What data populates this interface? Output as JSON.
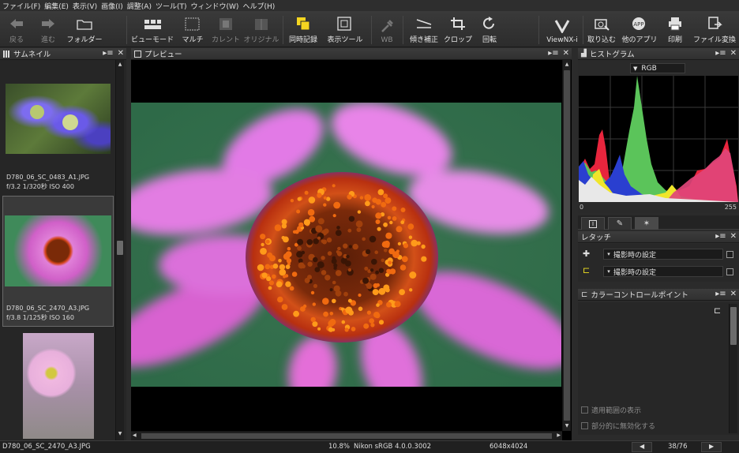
{
  "menu": [
    "ファイル(F)",
    "編集(E)",
    "表示(V)",
    "画像(I)",
    "調整(A)",
    "ツール(T)",
    "ウィンドウ(W)",
    "ヘルプ(H)"
  ],
  "toolbar": {
    "back": "戻る",
    "forward": "進む",
    "folder": "フォルダー",
    "view_mode": "ビューモード",
    "multi": "マルチ",
    "current": "カレント",
    "original": "オリジナル",
    "sync_record": "同時記録",
    "display_tool": "表示ツール",
    "wb": "WB",
    "tilt": "傾き補正",
    "crop": "クロップ",
    "rotate": "回転",
    "viewnx": "ViewNX-i",
    "import": "取り込む",
    "other_app": "他のアプリ",
    "print": "印刷",
    "file_convert": "ファイル変換"
  },
  "thumbnail_panel": {
    "title": "サムネイル",
    "items": [
      {
        "filename": "D780_06_SC_0483_A1.JPG",
        "info": "f/3.2 1/320秒 ISO 400"
      },
      {
        "filename": "D780_06_SC_2470_A3.JPG",
        "info": "f/3.8 1/125秒 ISO 160"
      }
    ]
  },
  "preview_panel": {
    "title": "プレビュー"
  },
  "histogram_panel": {
    "title": "ヒストグラム",
    "channel": "RGB",
    "min": "0",
    "max": "255"
  },
  "retouch_panel": {
    "title": "レタッチ",
    "rows": [
      {
        "value": "撮影時の設定"
      },
      {
        "value": "撮影時の設定"
      }
    ]
  },
  "ccp_panel": {
    "title": "カラーコントロールポイント",
    "options": [
      "適用範囲の表示",
      "部分的に無効化する"
    ]
  },
  "status": {
    "filename": "D780_06_SC_2470_A3.JPG",
    "zoom": "10.8%",
    "profile": "Nikon sRGB 4.0.0.3002",
    "dimensions": "6048x4024",
    "position": "38/76"
  },
  "colors": {
    "panel_bg": "#2b2b2b",
    "histogram_red": "#e8253d",
    "histogram_green": "#5bc45a",
    "histogram_blue": "#2a3fd0",
    "histogram_yellow": "#f0e62a",
    "histogram_magenta": "#e0457a"
  }
}
